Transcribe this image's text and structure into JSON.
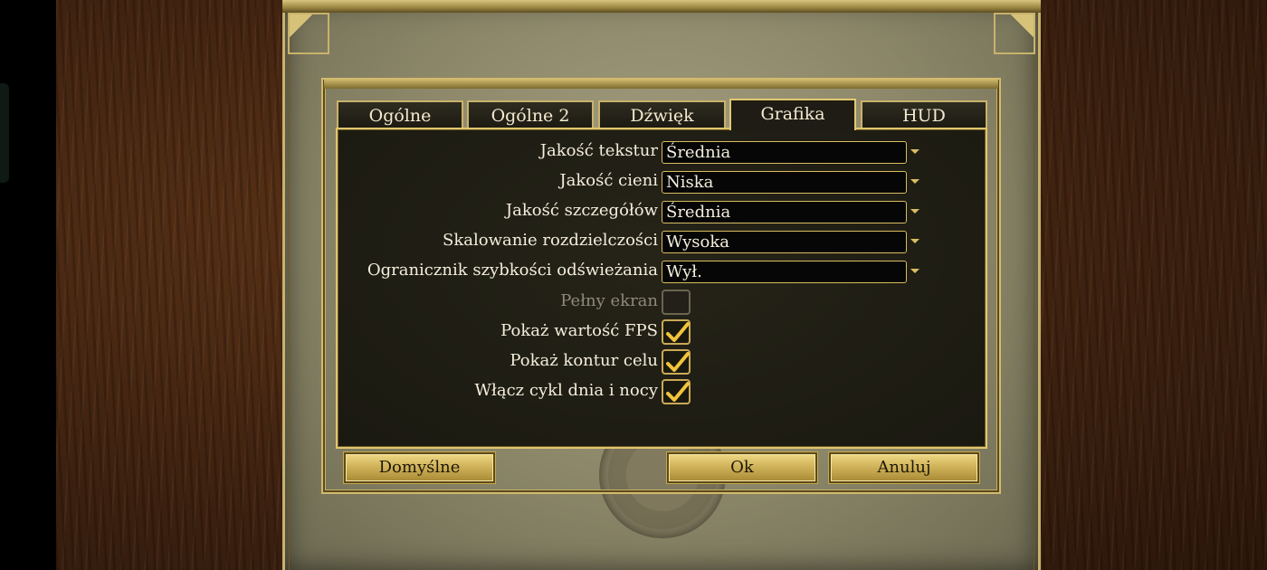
{
  "tabs": [
    {
      "label": "Ogólne",
      "active": false
    },
    {
      "label": "Ogólne 2",
      "active": false
    },
    {
      "label": "Dźwięk",
      "active": false
    },
    {
      "label": "Grafika",
      "active": true
    },
    {
      "label": "HUD",
      "active": false
    }
  ],
  "dropdowns": [
    {
      "label": "Jakość tekstur",
      "value": "Średnia"
    },
    {
      "label": "Jakość cieni",
      "value": "Niska"
    },
    {
      "label": "Jakość szczegółów",
      "value": "Średnia"
    },
    {
      "label": "Skalowanie rozdzielczości",
      "value": "Wysoka"
    },
    {
      "label": "Ogranicznik szybkości odświeżania",
      "value": "Wył."
    }
  ],
  "checkboxes": [
    {
      "label": "Pełny ekran",
      "checked": false,
      "disabled": true
    },
    {
      "label": "Pokaż wartość FPS",
      "checked": true,
      "disabled": false
    },
    {
      "label": "Pokaż kontur celu",
      "checked": true,
      "disabled": false
    },
    {
      "label": "Włącz cykl dnia i nocy",
      "checked": true,
      "disabled": false
    }
  ],
  "buttons": {
    "defaults": "Domyślne",
    "ok": "Ok",
    "cancel": "Anuluj"
  },
  "colors": {
    "gold_accent": "#e0c66e",
    "panel_bg": "#1a1911",
    "check_mark": "#f2c43a"
  },
  "icons": {
    "dropdown": "chevron-down-icon",
    "check": "checkmark-icon"
  }
}
